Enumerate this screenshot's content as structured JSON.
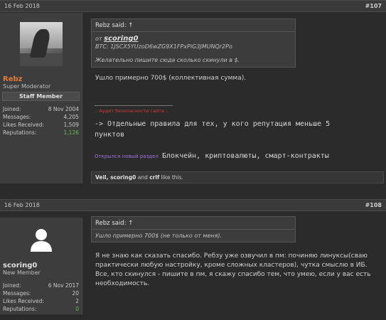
{
  "posts": [
    {
      "date": "16 Feb 2018",
      "number": "#107",
      "user": {
        "name": "Rebz",
        "name_color": "#e07b3a",
        "title": "Super Moderator",
        "banner": "Staff Member",
        "stats": [
          {
            "label": "Joined:",
            "value": "8 Nov 2004"
          },
          {
            "label": "Messages:",
            "value": "4,205"
          },
          {
            "label": "Likes Received:",
            "value": "1,509"
          },
          {
            "label": "Reputations:",
            "value": "1,126",
            "color": "#6bbf4a"
          }
        ]
      },
      "quote": {
        "author": "Rebz said: ↑",
        "from_prefix": "от ",
        "from_user": "scoring0",
        "btc": "BTC: 1JSCX5YUzoD6wZG9X1FPxPiG3JMUNQr2Po",
        "note": "Желательно пишите сюда сколько скинули в $."
      },
      "message": "Ушло примерно 700$ (коллективная сумма).",
      "signature": {
        "audit": ".: Аудит безопасности сайта :.",
        "rules": "-> Отдельные правила для тех, у кого репутация меньше 5",
        "rules2": "пунктов",
        "section_prefix": "Открылся новый раздел",
        "section_name": "Блокчейн, криптовалюты, смарт-контракты"
      },
      "likes": {
        "names": "Veil, scoring0",
        "and": " and ",
        "last": "crlf",
        "suffix": " like this."
      }
    },
    {
      "date": "16 Feb 2018",
      "number": "#108",
      "user": {
        "name": "scoring0",
        "title": "New Member",
        "stats": [
          {
            "label": "Joined:",
            "value": "6 Nov 2017"
          },
          {
            "label": "Messages:",
            "value": "20"
          },
          {
            "label": "Likes Received:",
            "value": "2"
          },
          {
            "label": "Reputations:",
            "value": "0",
            "color": "#6bbf4a"
          }
        ]
      },
      "quote": {
        "author": "Rebz said: ↑",
        "text": "Ушло примерно 700$ (не только от меня)."
      },
      "message": "Я не знаю как сказать спасибо. Ребзу уже озвучил в пм: починяю линуксы(сваю практически любую настройку, кроме сложных кластеров), чутка смыслю в ИБ. Все, кто скинулся - пишите в пм, я скажу спасибо тем, что умею, если у вас есть необходимость."
    }
  ],
  "colors": {
    "background": "#2b2b2b",
    "sidebar": "#3d3d3d",
    "reputation": "#6bbf4a",
    "signature_red": "#d23a3a",
    "signature_purple": "#a070d8"
  },
  "icons": {
    "default_avatar": "user-silhouette-icon"
  }
}
